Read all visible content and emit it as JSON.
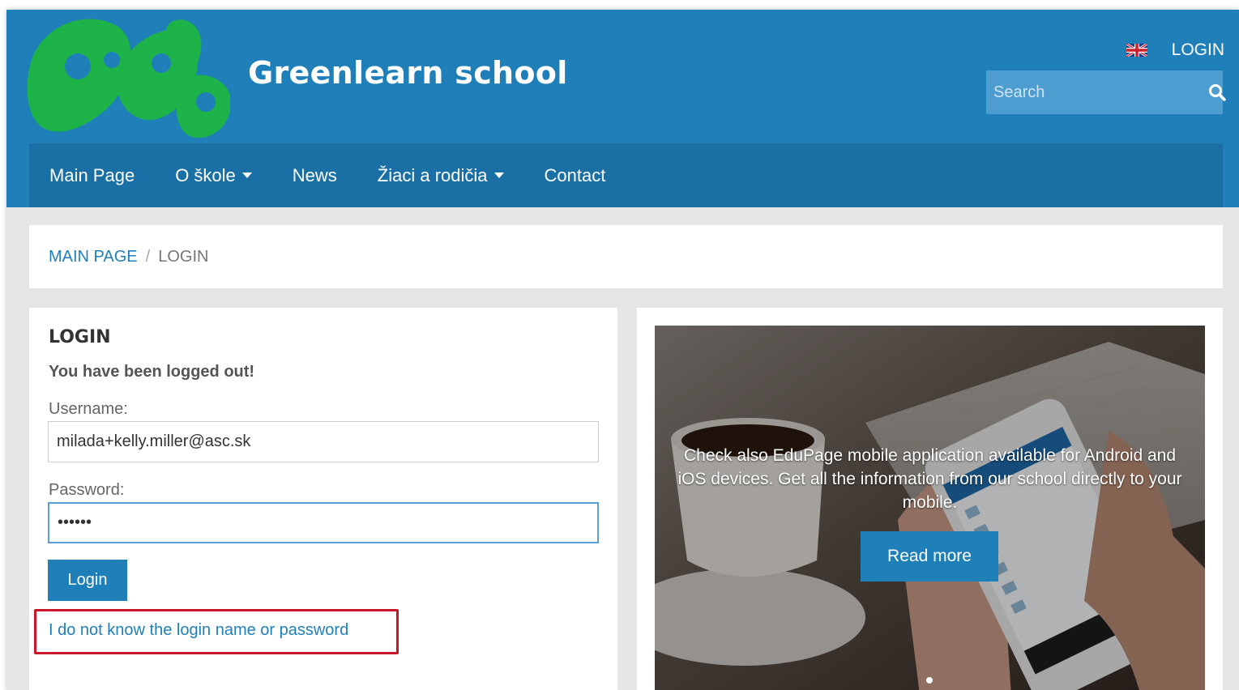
{
  "header": {
    "site_title": "Greenlearn school",
    "login_link": "LOGIN",
    "language_flag": "uk-flag-icon",
    "search": {
      "placeholder": "Search",
      "icon": "search-icon"
    }
  },
  "nav": {
    "items": [
      {
        "label": "Main Page",
        "has_dropdown": false
      },
      {
        "label": "O škole",
        "has_dropdown": true
      },
      {
        "label": "News",
        "has_dropdown": false
      },
      {
        "label": "Žiaci a rodičia",
        "has_dropdown": true
      },
      {
        "label": "Contact",
        "has_dropdown": false
      }
    ]
  },
  "breadcrumb": {
    "home": "MAIN PAGE",
    "separator": "/",
    "current": "LOGIN"
  },
  "login_form": {
    "title": "LOGIN",
    "message": "You have been logged out!",
    "username_label": "Username:",
    "username_value": "milada+kelly.miller@asc.sk",
    "password_label": "Password:",
    "password_value": "••••••",
    "submit_label": "Login",
    "forgot_link": "I do not know the login name or password"
  },
  "promo": {
    "text": "Check also EduPage mobile application available for Android and iOS devices. Get all the information from our school directly to your mobile.",
    "button_label": "Read more"
  },
  "colors": {
    "header_bg": "#1f7fb9",
    "nav_bg": "#1a6fa5",
    "logo_green": "#1db348",
    "highlight_red": "#c9182b"
  }
}
